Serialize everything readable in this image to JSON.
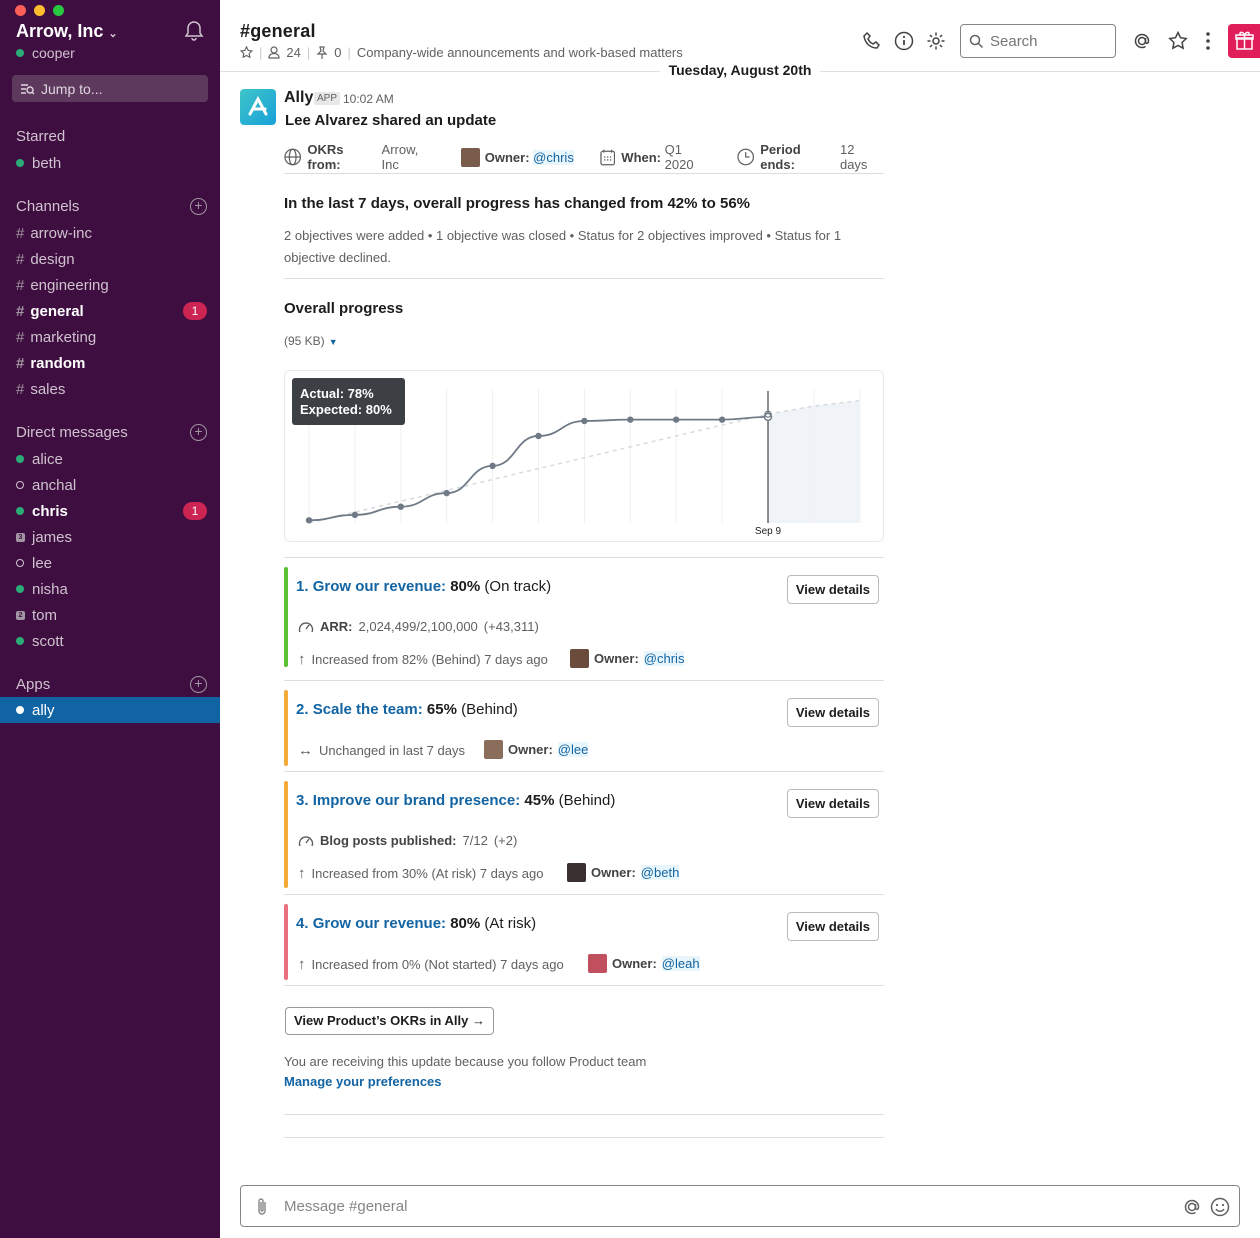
{
  "workspace": {
    "name": "Arrow, Inc",
    "user": "cooper"
  },
  "jump_label": "Jump to...",
  "sidebar": {
    "starred_header": "Starred",
    "starred": [
      "beth"
    ],
    "channels_header": "Channels",
    "channels": [
      {
        "label": "arrow-inc",
        "bold": false
      },
      {
        "label": "design",
        "bold": false
      },
      {
        "label": "engineering",
        "bold": false
      },
      {
        "label": "general",
        "bold": true,
        "badge": "1"
      },
      {
        "label": "marketing",
        "bold": false
      },
      {
        "label": "random",
        "bold": true
      },
      {
        "label": "sales",
        "bold": false
      }
    ],
    "dm_header": "Direct messages",
    "dms": [
      {
        "label": "alice",
        "status": "online"
      },
      {
        "label": "anchal",
        "status": "away"
      },
      {
        "label": "chris",
        "status": "online",
        "bold": true,
        "badge": "1"
      },
      {
        "label": "james",
        "status": "group",
        "count": "3"
      },
      {
        "label": "lee",
        "status": "away"
      },
      {
        "label": "nisha",
        "status": "online"
      },
      {
        "label": "tom",
        "status": "group",
        "count": "2"
      },
      {
        "label": "scott",
        "status": "online"
      }
    ],
    "apps_header": "Apps",
    "apps": [
      "ally"
    ]
  },
  "header": {
    "channel": "#general",
    "members": "24",
    "pins": "0",
    "topic": "Company-wide announcements and work-based matters",
    "search_placeholder": "Search"
  },
  "date_divider": "Tuesday, August 20th",
  "message": {
    "author": "Ally",
    "app_tag": "APP",
    "time": "10:02 AM",
    "text": "Lee Alvarez shared an update",
    "meta": {
      "okrs_key": "OKRs from:",
      "okrs_val": "Arrow, Inc",
      "owner_key": "Owner:",
      "owner_val": "@chris",
      "when_key": "When:",
      "when_val": "Q1 2020",
      "period_key": "Period ends:",
      "period_val": "12 days"
    },
    "change_title": "In the last 7 days, overall progress has changed from 42% to 56%",
    "change_sub": "2 objectives were added • 1 objective was closed • Status for 2 objectives improved • Status for 1 objective declined.",
    "progress_title": "Overall progress",
    "progress_size": "(95 KB)",
    "tooltip_actual": "Actual: 78%",
    "tooltip_expected": "Expected: 80%",
    "objectives": [
      {
        "num": "1.",
        "name": "Grow our revenue:",
        "pct": "80%",
        "status": "(On track)",
        "color": "#5bc236",
        "metric_key": "ARR:",
        "metric_val": "2,024,499/2,100,000",
        "metric_delta": "(+43,311)",
        "trend": "Increased from 82% (Behind) 7 days ago",
        "trend_icon": "arrow-up",
        "owner_key": "Owner:",
        "owner": "@chris",
        "button": "View details"
      },
      {
        "num": "2.",
        "name": "Scale the team:",
        "pct": "65%",
        "status": "(Behind)",
        "color": "#f4a93b",
        "trend": "Unchanged in last 7 days",
        "trend_icon": "arrow-left-right",
        "owner_key": "Owner:",
        "owner": "@lee",
        "button": "View details"
      },
      {
        "num": "3.",
        "name": "Improve our brand presence:",
        "pct": "45%",
        "status": "(Behind)",
        "color": "#f4a93b",
        "metric_key": "Blog posts published:",
        "metric_val": "7/12",
        "metric_delta": "(+2)",
        "trend": "Increased from 30% (At risk) 7 days ago",
        "trend_icon": "arrow-up",
        "owner_key": "Owner:",
        "owner": "@beth",
        "button": "View details"
      },
      {
        "num": "4.",
        "name": "Grow our revenue:",
        "pct": "80%",
        "status": "(At risk)",
        "color": "#ea6f7e",
        "trend": "Increased from 0% (Not started) 7 days ago",
        "trend_icon": "arrow-up",
        "owner_key": "Owner:",
        "owner": "@leah",
        "button": "View details"
      }
    ],
    "cta": "View Product’s OKRs in Ally →",
    "receiving": "You are receiving this update because you follow Product team",
    "manage": "Manage your preferences"
  },
  "composer_placeholder": "Message #general",
  "chart_data": {
    "type": "line",
    "x_labels": [
      "Sep 9"
    ],
    "series": [
      {
        "values": [
          2,
          6,
          12,
          22,
          42,
          64,
          75,
          76,
          76,
          76,
          78
        ]
      },
      {
        "values": [
          0,
          8,
          16,
          24,
          32,
          40,
          48,
          56,
          64,
          72,
          80,
          86,
          90
        ]
      }
    ],
    "ylim": [
      0,
      100
    ],
    "highlight_index": 10
  },
  "colors": {
    "sidebar": "#3f0e40",
    "selected": "#1164a3",
    "badge": "#cd2553",
    "link": "#1264a3"
  }
}
